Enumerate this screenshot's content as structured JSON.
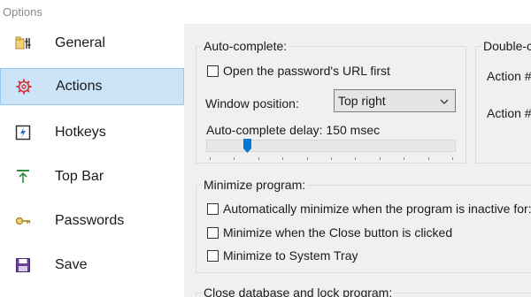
{
  "window": {
    "title": "Options"
  },
  "sidebar": {
    "items": [
      {
        "label": "General",
        "icon": "general-icon"
      },
      {
        "label": "Actions",
        "icon": "gear-icon",
        "selected": true
      },
      {
        "label": "Hotkeys",
        "icon": "hotkey-icon"
      },
      {
        "label": "Top Bar",
        "icon": "top-bar-icon"
      },
      {
        "label": "Passwords",
        "icon": "key-icon"
      },
      {
        "label": "Save",
        "icon": "save-icon"
      }
    ]
  },
  "autocomplete": {
    "title": "Auto-complete:",
    "open_url_first": {
      "label": "Open the password's URL first",
      "checked": false
    },
    "window_position_label": "Window position:",
    "window_position_value": "Top right",
    "delay_label": "Auto-complete delay: 150 msec",
    "delay_fraction": 0.15
  },
  "doubleclick": {
    "title": "Double-c",
    "action1_label": "Action #",
    "action2_label": "Action #"
  },
  "minimize": {
    "title": "Minimize program:",
    "auto_minimize": {
      "label": "Automatically minimize when the program is inactive for:",
      "checked": false
    },
    "close_button": {
      "label": "Minimize when the Close button is clicked",
      "checked": false
    },
    "system_tray": {
      "label": "Minimize to System Tray",
      "checked": false
    }
  },
  "close_db": {
    "title": "Close database and lock program:"
  },
  "colors": {
    "selected_bg": "#cce4f7",
    "slider_thumb": "#0078d7",
    "gear": "#d13438"
  }
}
